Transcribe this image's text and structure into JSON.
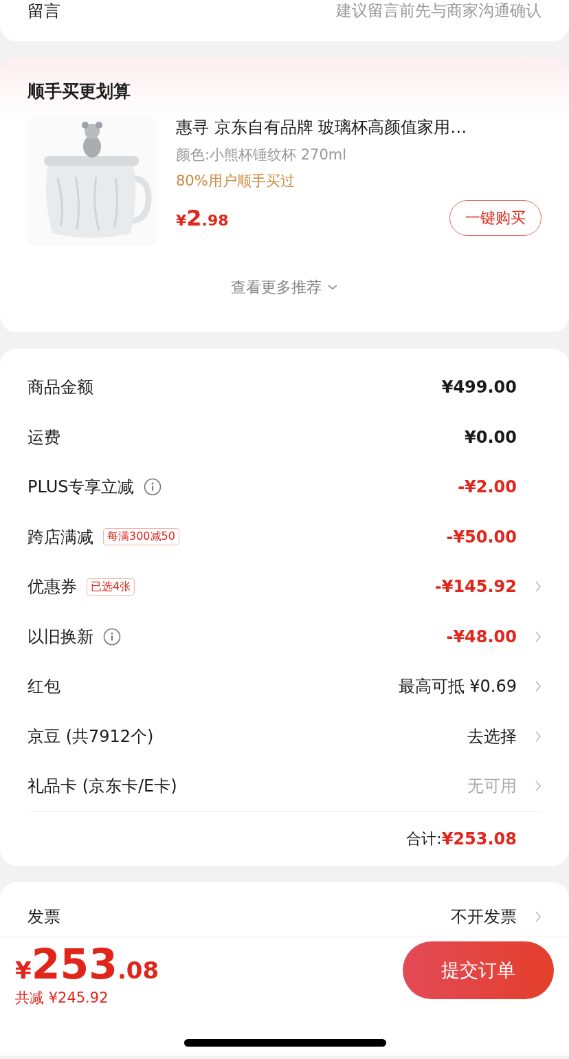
{
  "note_row": {
    "label": "留言",
    "placeholder": "建议留言前先与商家沟通确认"
  },
  "upsell": {
    "title": "顺手买更划算",
    "product": {
      "name": "惠寻 京东自有品牌 玻璃杯高颜值家用…",
      "spec": "颜色:小熊杯锤纹杯 270ml",
      "social": "80%用户顺手买过",
      "currency": "¥",
      "price_int": "2",
      "price_dec": ".98",
      "buy_button": "一键购买"
    },
    "more": "查看更多推荐"
  },
  "summary": {
    "rows": [
      {
        "label": "商品金额",
        "info": false,
        "value": "¥499.00",
        "kind": "price",
        "chevron": false
      },
      {
        "label": "运费",
        "info": false,
        "value": "¥0.00",
        "kind": "price",
        "chevron": false
      },
      {
        "label": "PLUS专享立减",
        "info": true,
        "value": "-¥2.00",
        "kind": "discount",
        "chevron": false
      },
      {
        "label": "跨店满减",
        "tag": "每满300减50",
        "info": false,
        "value": "-¥50.00",
        "kind": "discount",
        "chevron": false
      },
      {
        "label": "优惠券",
        "tag": "已选4张",
        "info": false,
        "value": "-¥145.92",
        "kind": "discount",
        "chevron": true
      },
      {
        "label": "以旧换新",
        "info": true,
        "value": "-¥48.00",
        "kind": "discount",
        "chevron": true
      },
      {
        "label": "红包",
        "info": false,
        "value": "最高可抵 ¥0.69",
        "kind": "plain",
        "chevron": true
      },
      {
        "label": "京豆 (共7912个)",
        "info": false,
        "value": "去选择",
        "kind": "plain",
        "chevron": true
      },
      {
        "label": "礼品卡 (京东卡/E卡)",
        "info": false,
        "value": "无可用",
        "kind": "muted",
        "chevron": true
      }
    ],
    "total_label": "合计:",
    "total_value": "¥253.08"
  },
  "invoice": {
    "label": "发票",
    "value": "不开发票"
  },
  "bottom_bar": {
    "currency": "¥",
    "total_int": "253",
    "total_dec": ".08",
    "saved": "共减 ¥245.92",
    "submit": "提交订单"
  }
}
